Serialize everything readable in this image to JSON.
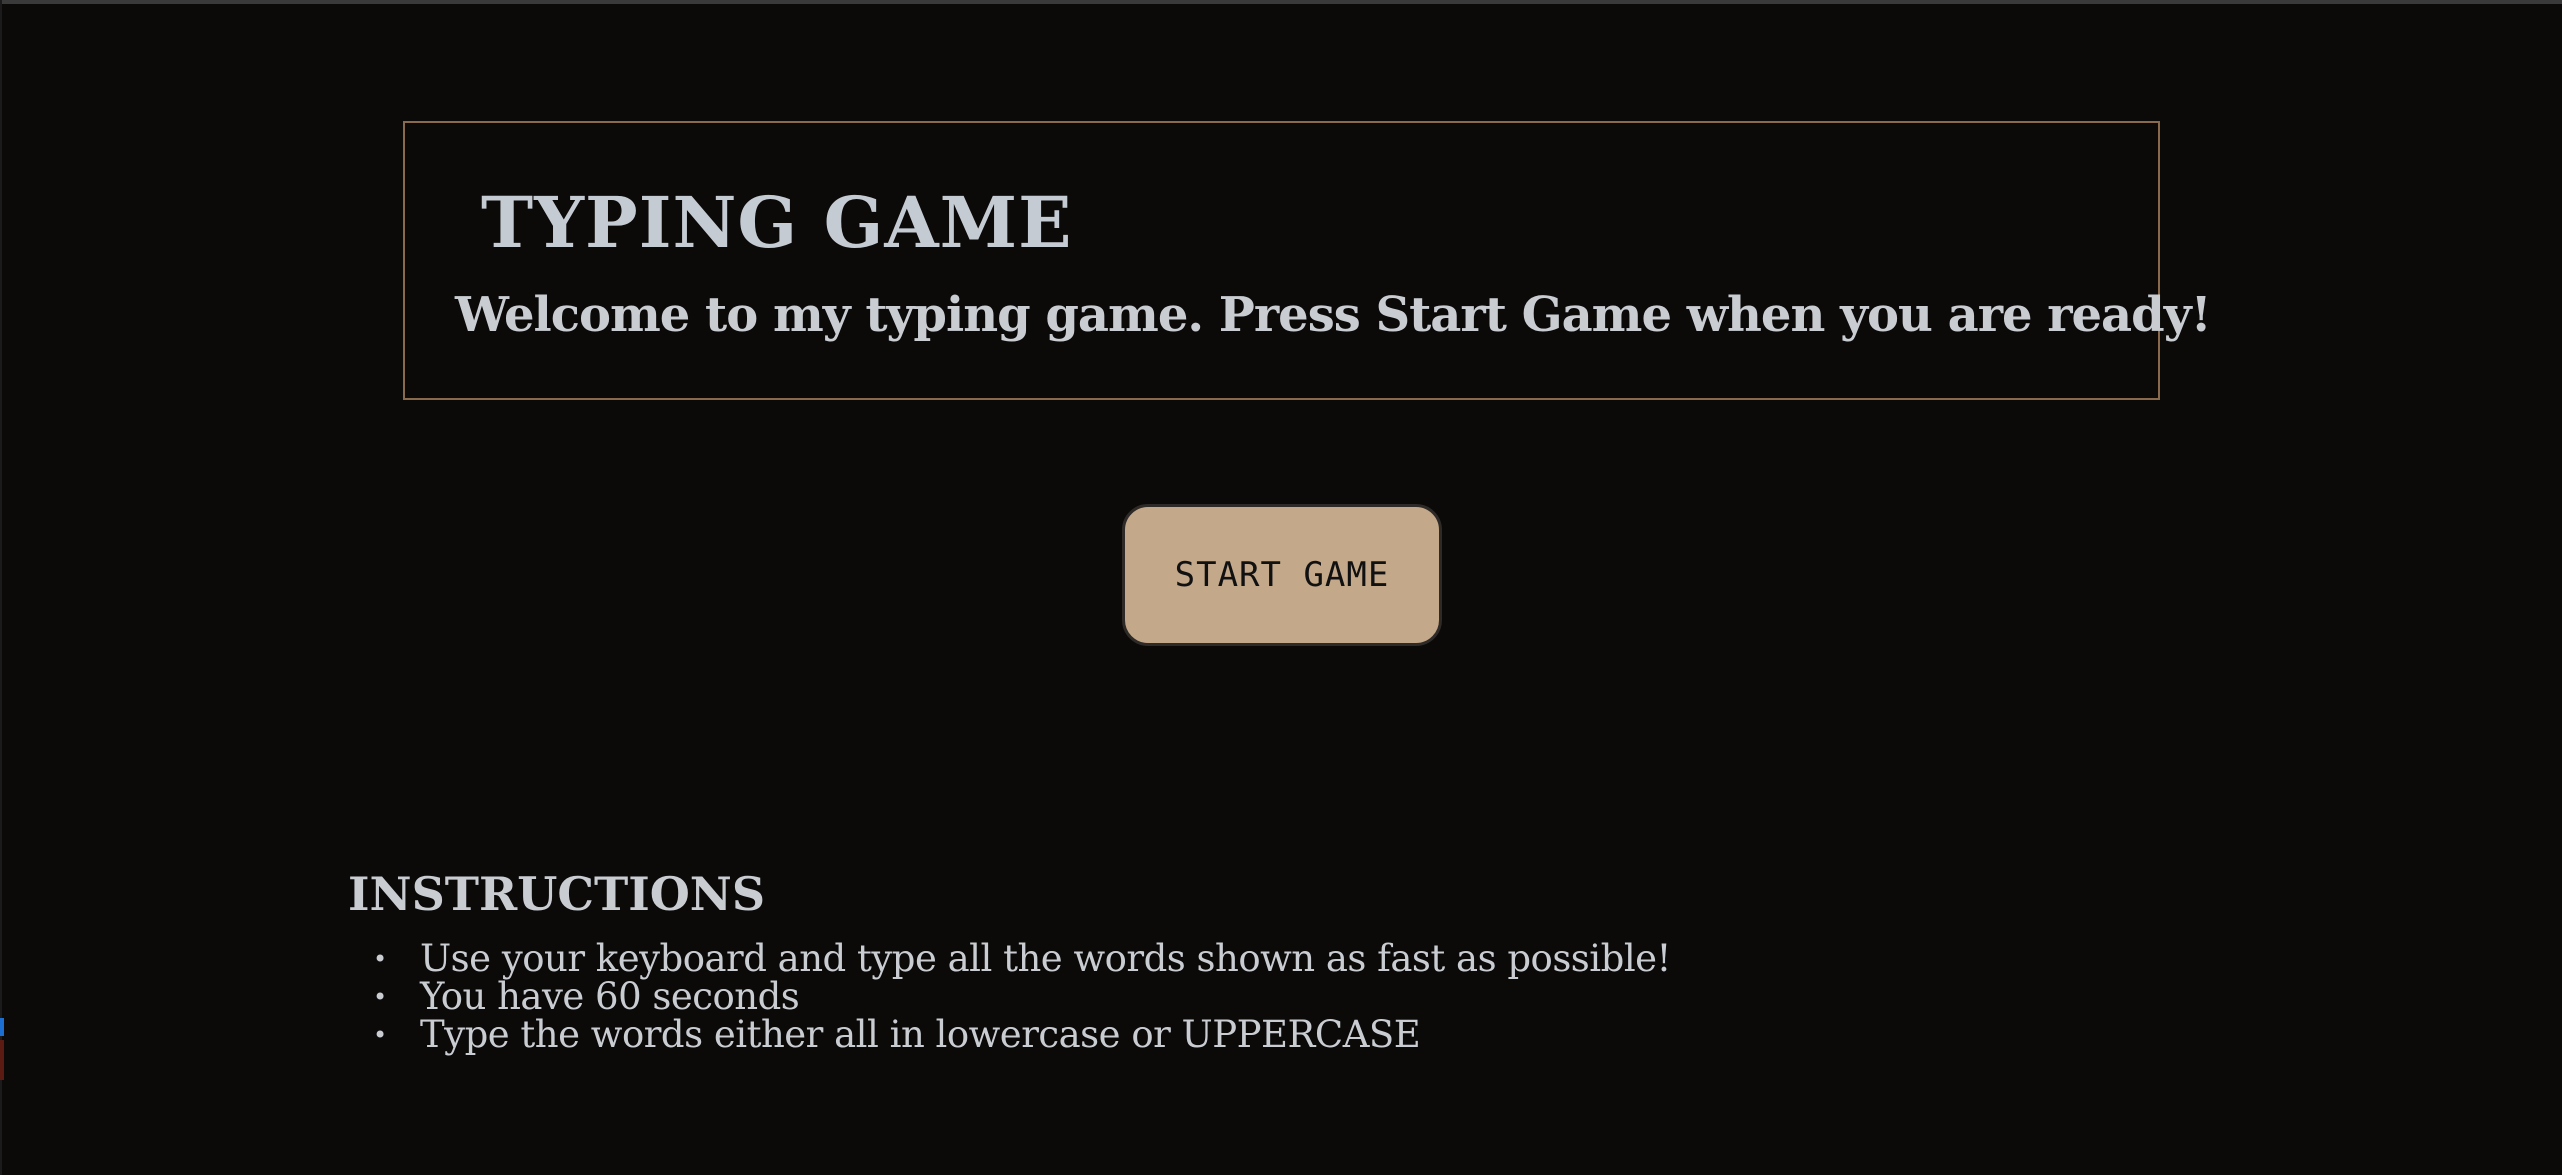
{
  "header": {
    "title": "TYPING GAME",
    "subtitle": "Welcome to my typing game. Press Start Game when you are ready!"
  },
  "actions": {
    "start_label": "START GAME"
  },
  "instructions": {
    "heading": "INSTRUCTIONS",
    "items": [
      "Use your keyboard and type all the words shown as fast as possible!",
      "You have 60 seconds",
      "Type the words either all in lowercase or UPPERCASE"
    ]
  },
  "colors": {
    "background": "#0b0a09",
    "accent_border": "#8a6a4c",
    "button": "#c3a88a",
    "text": "#c9cdd2"
  }
}
